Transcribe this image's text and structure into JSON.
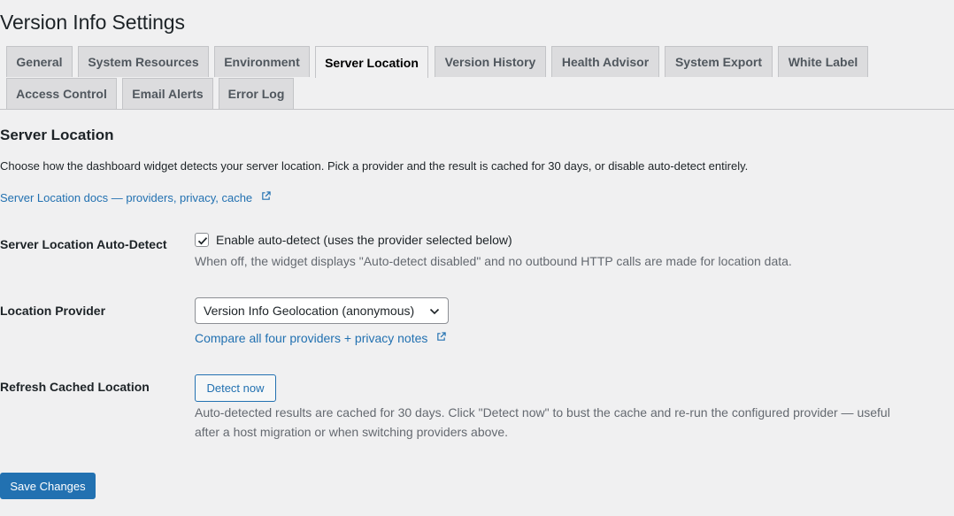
{
  "page": {
    "title": "Version Info Settings"
  },
  "tabs": [
    {
      "label": "General"
    },
    {
      "label": "System Resources"
    },
    {
      "label": "Environment"
    },
    {
      "label": "Server Location",
      "active": true
    },
    {
      "label": "Version History"
    },
    {
      "label": "Health Advisor"
    },
    {
      "label": "System Export"
    },
    {
      "label": "White Label"
    },
    {
      "label": "Access Control"
    },
    {
      "label": "Email Alerts"
    },
    {
      "label": "Error Log"
    }
  ],
  "section": {
    "title": "Server Location",
    "intro": "Choose how the dashboard widget detects your server location. Pick a provider and the result is cached for 30 days, or disable auto-detect entirely.",
    "docs_link": "Server Location docs — providers, privacy, cache"
  },
  "auto_detect": {
    "label": "Server Location Auto-Detect",
    "checkbox_label": "Enable auto-detect (uses the provider selected below)",
    "checked": true,
    "description": "When off, the widget displays \"Auto-detect disabled\" and no outbound HTTP calls are made for location data."
  },
  "provider": {
    "label": "Location Provider",
    "selected": "Version Info Geolocation (anonymous)",
    "compare_link": "Compare all four providers + privacy notes"
  },
  "refresh": {
    "label": "Refresh Cached Location",
    "button": "Detect now",
    "description_line1": "Auto-detected results are cached for 30 days. Click \"Detect now\" to bust the cache and re-run the configured provider — useful",
    "description_line2": "after a host migration or when switching providers above."
  },
  "actions": {
    "save": "Save Changes"
  },
  "colors": {
    "accent": "#2271b1",
    "background": "#f0f0f1",
    "tab_inactive": "#dcdcde",
    "border": "#c3c4c7"
  }
}
